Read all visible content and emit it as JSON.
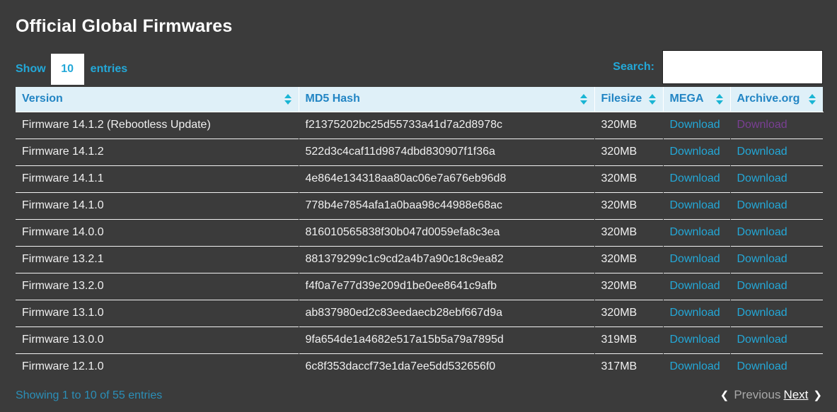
{
  "page": {
    "title": "Official Global Firmwares",
    "background_color": "#3b3b3b",
    "accent_color": "#23a8d8",
    "header_bg_color": "#dff0f8",
    "visited_link_color": "#7a3f94"
  },
  "controls": {
    "length": {
      "label_before": "Show",
      "value": "10",
      "label_after": "entries"
    },
    "search": {
      "label": "Search:",
      "value": "",
      "placeholder": ""
    }
  },
  "table": {
    "columns": [
      {
        "label": "Version",
        "sortable": true,
        "sort_icon": "sort-both-icon"
      },
      {
        "label": "MD5 Hash",
        "sortable": true,
        "sort_icon": "sort-both-icon"
      },
      {
        "label": "Filesize",
        "sortable": true,
        "sort_icon": "sort-both-icon"
      },
      {
        "label": "MEGA",
        "sortable": true,
        "sort_icon": "sort-both-icon"
      },
      {
        "label": "Archive.org",
        "sortable": true,
        "sort_icon": "sort-both-icon"
      }
    ],
    "link_label": "Download",
    "rows": [
      {
        "version": "Firmware 14.1.2 (Rebootless Update)",
        "md5": "f21375202bc25d55733a41d7a2d8978c",
        "filesize": "320MB",
        "mega": "Download",
        "archive": "Download",
        "archive_visited": true
      },
      {
        "version": "Firmware 14.1.2",
        "md5": "522d3c4caf11d9874dbd830907f1f36a",
        "filesize": "320MB",
        "mega": "Download",
        "archive": "Download",
        "archive_visited": false
      },
      {
        "version": "Firmware 14.1.1",
        "md5": "4e864e134318aa80ac06e7a676eb96d8",
        "filesize": "320MB",
        "mega": "Download",
        "archive": "Download",
        "archive_visited": false
      },
      {
        "version": "Firmware 14.1.0",
        "md5": "778b4e7854afa1a0baa98c44988e68ac",
        "filesize": "320MB",
        "mega": "Download",
        "archive": "Download",
        "archive_visited": false
      },
      {
        "version": "Firmware 14.0.0",
        "md5": "816010565838f30b047d0059efa8c3ea",
        "filesize": "320MB",
        "mega": "Download",
        "archive": "Download",
        "archive_visited": false
      },
      {
        "version": "Firmware 13.2.1",
        "md5": "881379299c1c9cd2a4b7a90c18c9ea82",
        "filesize": "320MB",
        "mega": "Download",
        "archive": "Download",
        "archive_visited": false
      },
      {
        "version": "Firmware 13.2.0",
        "md5": "f4f0a7e77d39e209d1be0ee8641c9afb",
        "filesize": "320MB",
        "mega": "Download",
        "archive": "Download",
        "archive_visited": false
      },
      {
        "version": "Firmware 13.1.0",
        "md5": "ab837980ed2c83eedaecb28ebf667d9a",
        "filesize": "320MB",
        "mega": "Download",
        "archive": "Download",
        "archive_visited": false
      },
      {
        "version": "Firmware 13.0.0",
        "md5": "9fa654de1a4682e517a15b5a79a7895d",
        "filesize": "319MB",
        "mega": "Download",
        "archive": "Download",
        "archive_visited": false
      },
      {
        "version": "Firmware 12.1.0",
        "md5": "6c8f353daccf73e1da7ee5dd532656f0",
        "filesize": "317MB",
        "mega": "Download",
        "archive": "Download",
        "archive_visited": false
      }
    ]
  },
  "footer": {
    "info": "Showing 1 to 10 of 55 entries",
    "pagination": {
      "previous_label": "Previous",
      "next_label": "Next",
      "previous_disabled": true,
      "next_hover": true,
      "prev_arrow_icon": "chevron-left-icon",
      "next_arrow_icon": "chevron-right-icon"
    }
  }
}
